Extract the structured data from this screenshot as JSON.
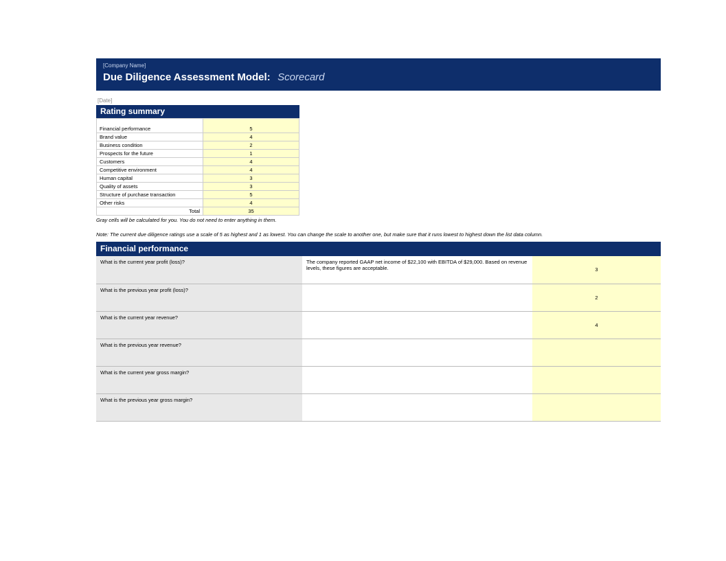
{
  "header": {
    "company": "[Company Name]",
    "title": "Due Diligence Assessment Model:",
    "subtitle": "Scorecard",
    "date": "[Date]"
  },
  "summary": {
    "title": "Rating summary",
    "rows": [
      {
        "label": "Financial performance",
        "value": "5"
      },
      {
        "label": "Brand value",
        "value": "4"
      },
      {
        "label": "Business condition",
        "value": "2"
      },
      {
        "label": "Prospects for the future",
        "value": "1"
      },
      {
        "label": "Customers",
        "value": "4"
      },
      {
        "label": "Competitive environment",
        "value": "4"
      },
      {
        "label": "Human capital",
        "value": "3"
      },
      {
        "label": "Quality of assets",
        "value": "3"
      },
      {
        "label": "Structure of purchase transaction",
        "value": "5"
      },
      {
        "label": "Other risks",
        "value": "4"
      }
    ],
    "total_label": "Total",
    "total_value": "35"
  },
  "notes": {
    "gray": "Gray cells will be calculated for you. You do not need to enter anything in them.",
    "scale": "Note: The current due diligence ratings use a scale of 5 as highest and 1 as lowest. You can change the scale to another one, but make sure that it runs lowest to highest down the list data column."
  },
  "section": {
    "title": "Financial performance",
    "rows": [
      {
        "question": "What is the current year profit (loss)?",
        "answer": "The company reported GAAP net income of $22,100 with EBITDA of $29,000. Based on revenue levels, these figures are acceptable.",
        "rating": "3"
      },
      {
        "question": "What is the previous year profit (loss)?",
        "answer": "",
        "rating": "2"
      },
      {
        "question": "What is the current year revenue?",
        "answer": "",
        "rating": "4"
      },
      {
        "question": "What is the previous year revenue?",
        "answer": "",
        "rating": ""
      },
      {
        "question": "What is the current year gross margin?",
        "answer": "",
        "rating": ""
      },
      {
        "question": "What is the previous year gross margin?",
        "answer": "",
        "rating": ""
      }
    ]
  }
}
